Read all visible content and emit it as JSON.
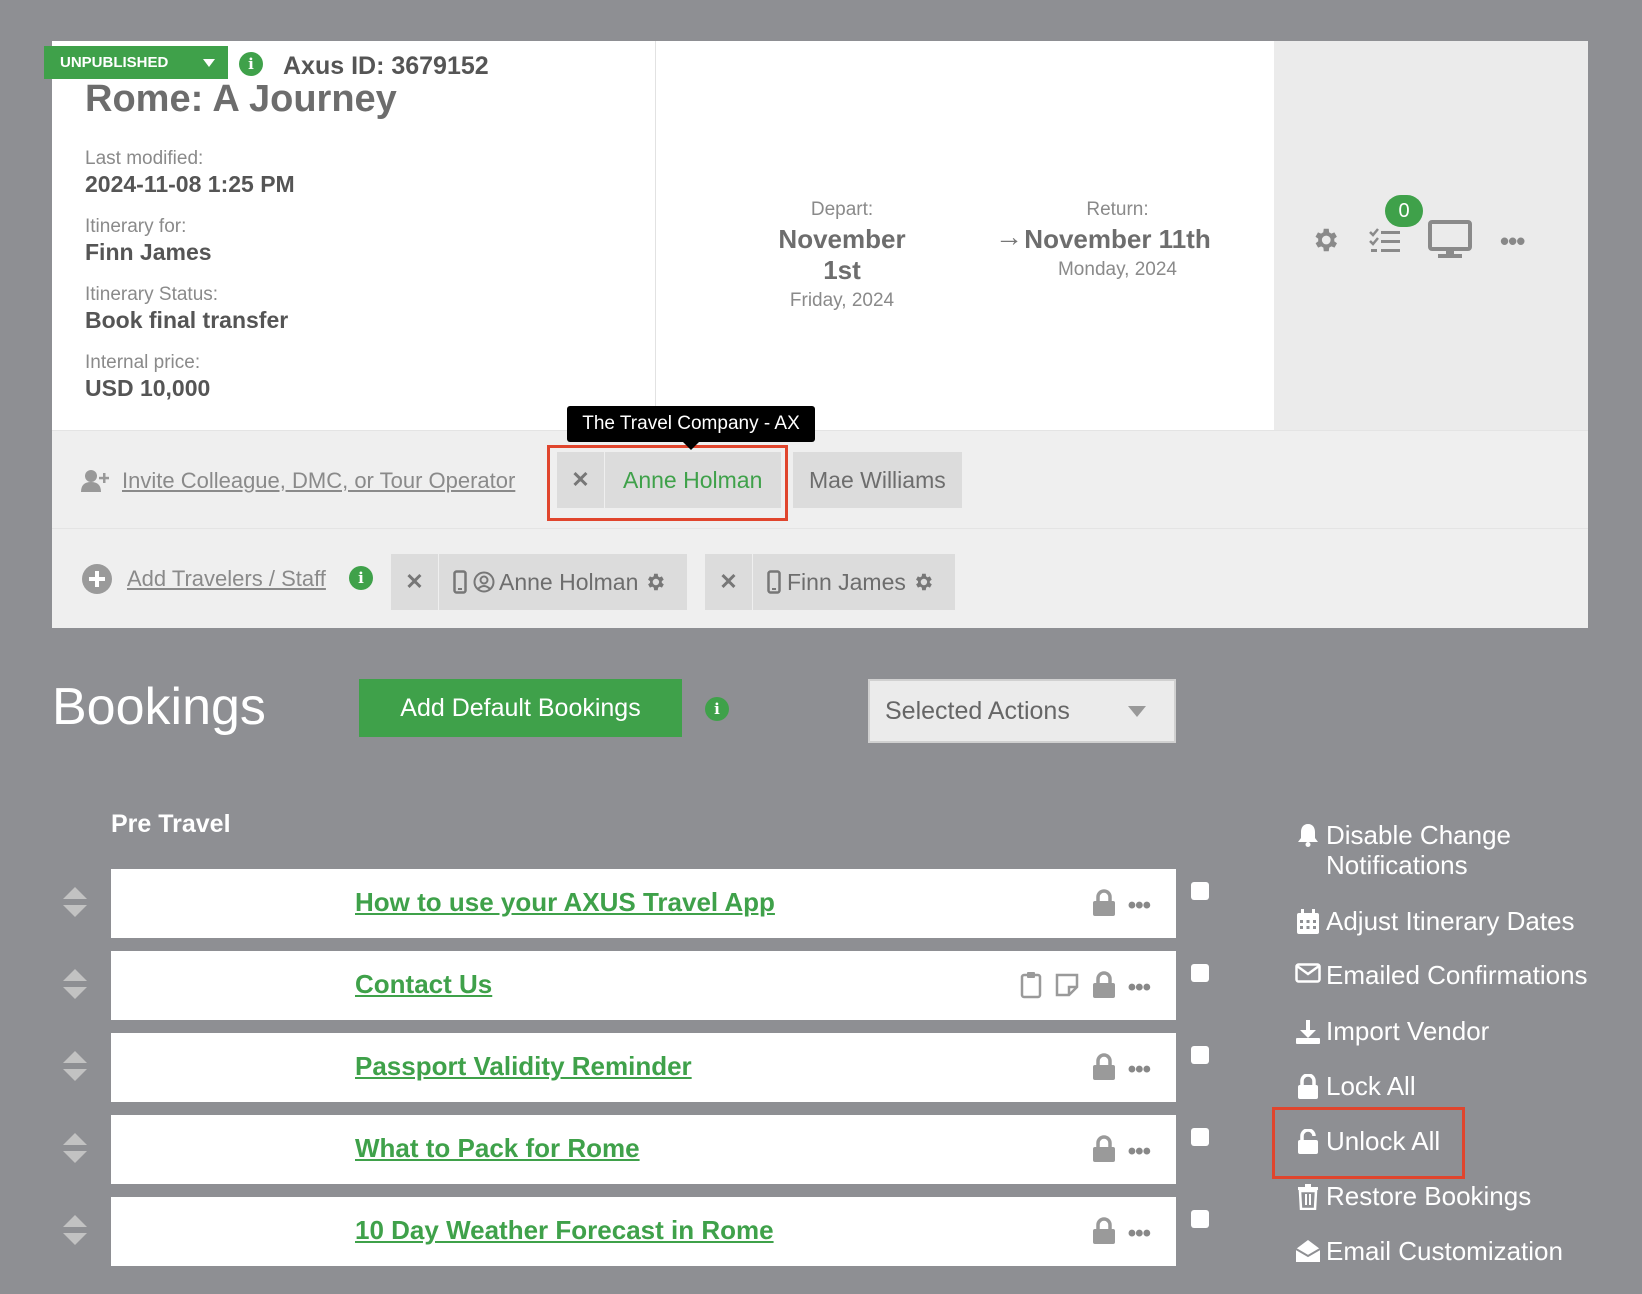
{
  "header": {
    "status": "UNPUBLISHED",
    "axus_id": "Axus ID: 3679152",
    "title": "Rome: A Journey",
    "meta": [
      {
        "label": "Last modified:",
        "value": "2024-11-08 1:25 PM"
      },
      {
        "label": "Itinerary for:",
        "value": "Finn James"
      },
      {
        "label": "Itinerary Status:",
        "value": "Book final transfer"
      },
      {
        "label": "Internal price:",
        "value": "USD 10,000"
      }
    ],
    "depart": {
      "label": "Depart:",
      "date": "November 1st",
      "sub": "Friday, 2024"
    },
    "return": {
      "label": "Return:",
      "date": "November 11th",
      "sub": "Monday, 2024"
    },
    "arrow": "→",
    "task_count": "0",
    "icons": [
      "gear-icon",
      "checklist-icon",
      "desktop-icon",
      "more-icon"
    ]
  },
  "collaborators": {
    "invite_link": "Invite Colleague, DMC, or Tour Operator",
    "tooltip": "The Travel Company - AX",
    "chips": [
      "Anne Holman",
      "Mae Williams"
    ],
    "remove_symbol": "✕"
  },
  "travelers": {
    "add_link": "Add Travelers / Staff",
    "chips": [
      "Anne Holman",
      "Finn James"
    ]
  },
  "bookings": {
    "title": "Bookings",
    "add_default": "Add Default Bookings",
    "selected_actions": "Selected Actions",
    "section": "Pre Travel",
    "items": [
      {
        "title": "How to use your AXUS Travel App"
      },
      {
        "title": "Contact Us"
      },
      {
        "title": "Passport Validity Reminder"
      },
      {
        "title": "What to Pack for Rome"
      },
      {
        "title": "10 Day Weather Forecast in Rome"
      }
    ],
    "more": "•••"
  },
  "side_menu": [
    {
      "label": "Disable Change",
      "label2": "Notifications",
      "icon": "bell-icon"
    },
    {
      "label": "Adjust Itinerary Dates",
      "icon": "calendar-icon"
    },
    {
      "label": "Emailed Confirmations",
      "icon": "envelope-icon"
    },
    {
      "label": "Import Vendor",
      "icon": "import-icon"
    },
    {
      "label": "Lock All",
      "icon": "lock-icon"
    },
    {
      "label": "Unlock All",
      "icon": "unlock-icon"
    },
    {
      "label": "Restore Bookings",
      "icon": "trash-icon"
    },
    {
      "label": "Email Customization",
      "icon": "envelope-open-icon"
    }
  ],
  "colors": {
    "accent_green": "#3fa14a",
    "highlight_red": "#e0452d",
    "background": "#8e8f93"
  }
}
